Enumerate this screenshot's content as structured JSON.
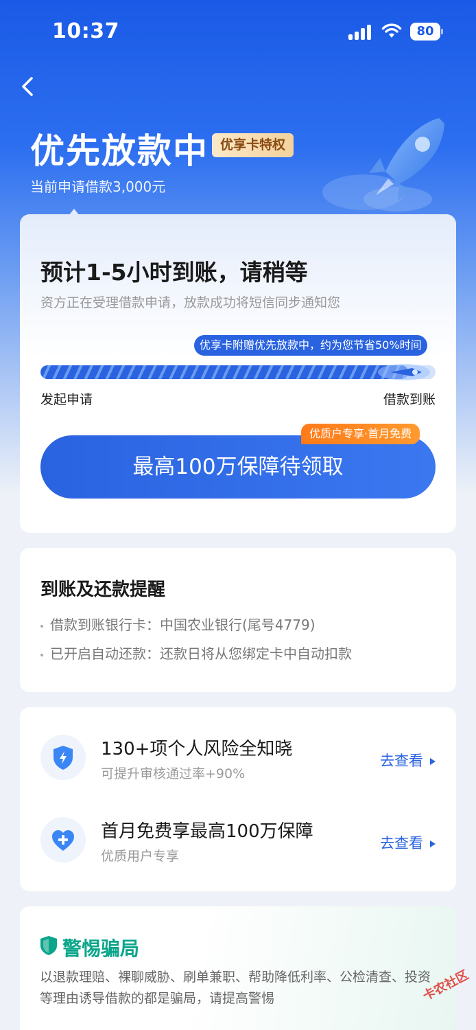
{
  "status_bar": {
    "time": "10:37",
    "battery": "80"
  },
  "header": {
    "title": "优先放款中",
    "badge": "优享卡特权",
    "subtitle": "当前申请借款3,000元"
  },
  "status_card": {
    "title": "预计1-5小时到账，请稍等",
    "subtitle": "资方正在受理借款申请，放款成功将短信同步通知您",
    "tip": "优享卡附赠优先放款中，约为您节省50%时间",
    "progress": 0.93,
    "step_start": "发起申请",
    "step_end": "借款到账",
    "promo_button": "最高100万保障待领取",
    "promo_tag": "优质户专享·首月免费"
  },
  "reminder": {
    "title": "到账及还款提醒",
    "items": [
      "借款到账银行卡：中国农业银行(尾号4779)",
      "已开启自动还款：还款日将从您绑定卡中自动扣款"
    ]
  },
  "services": [
    {
      "title": "130+项个人风险全知晓",
      "subtitle": "可提升审核通过率+90%",
      "link": "去查看",
      "icon": "shield-icon"
    },
    {
      "title": "首月免费享最高100万保障",
      "subtitle": "优质用户专享",
      "link": "去查看",
      "icon": "heart-plus-icon"
    }
  ],
  "warning": {
    "title": "警惕骗局",
    "text": "以退款理赔、裸聊威胁、刷单兼职、帮助降低利率、公检清查、投资等理由诱导借款的都是骗局，请提高警惕"
  },
  "watermark": "卡农社区",
  "colors": {
    "primary": "#2a63e0",
    "orange": "#ff7a1a",
    "green": "#0aa58a"
  }
}
